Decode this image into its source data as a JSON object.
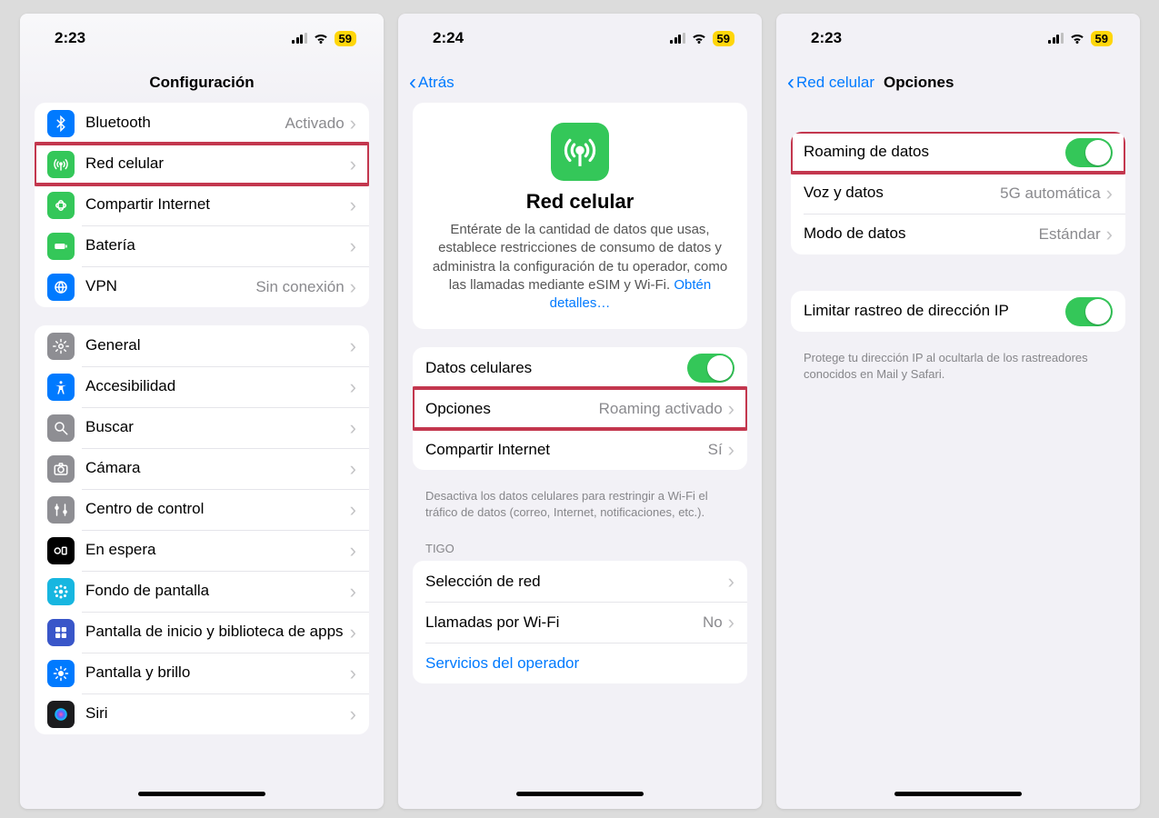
{
  "screen1": {
    "time": "2:23",
    "battery": "59",
    "title": "Configuración",
    "group1": [
      {
        "icon": "bluetooth",
        "bg": "#007aff",
        "label": "Bluetooth",
        "value": "Activado"
      },
      {
        "icon": "cellular",
        "bg": "#34c759",
        "label": "Red celular",
        "value": "",
        "hl": true
      },
      {
        "icon": "hotspot",
        "bg": "#34c759",
        "label": "Compartir Internet",
        "value": ""
      },
      {
        "icon": "battery",
        "bg": "#34c759",
        "label": "Batería",
        "value": ""
      },
      {
        "icon": "vpn",
        "bg": "#007aff",
        "label": "VPN",
        "value": "Sin conexión"
      }
    ],
    "group2": [
      {
        "icon": "general",
        "bg": "#8e8e93",
        "label": "General"
      },
      {
        "icon": "accessibility",
        "bg": "#007aff",
        "label": "Accesibilidad"
      },
      {
        "icon": "search",
        "bg": "#8e8e93",
        "label": "Buscar"
      },
      {
        "icon": "camera",
        "bg": "#8e8e93",
        "label": "Cámara"
      },
      {
        "icon": "control",
        "bg": "#8e8e93",
        "label": "Centro de control"
      },
      {
        "icon": "standby",
        "bg": "#000000",
        "label": "En espera"
      },
      {
        "icon": "wallpaper",
        "bg": "#17b6e0",
        "label": "Fondo de pantalla"
      },
      {
        "icon": "homescreen",
        "bg": "#3956c9",
        "label": "Pantalla de inicio y biblioteca de apps",
        "two": true
      },
      {
        "icon": "display",
        "bg": "#007aff",
        "label": "Pantalla y brillo"
      },
      {
        "icon": "siri",
        "bg": "#1c1c1e",
        "label": "Siri"
      }
    ]
  },
  "screen2": {
    "time": "2:24",
    "battery": "59",
    "back": "Atrás",
    "hero_title": "Red celular",
    "hero_text": "Entérate de la cantidad de datos que usas, establece restricciones de consumo de datos y administra la configuración de tu operador, como las llamadas mediante eSIM y Wi-Fi. ",
    "hero_link": "Obtén detalles…",
    "group1": [
      {
        "label": "Datos celulares",
        "type": "toggle"
      },
      {
        "label": "Opciones",
        "value": "Roaming activado",
        "hl": true
      },
      {
        "label": "Compartir Internet",
        "value": "Sí"
      }
    ],
    "footer1": "Desactiva los datos celulares para restringir a Wi-Fi el tráfico de datos (correo, Internet, notificaciones, etc.).",
    "section": "TIGO",
    "group2": [
      {
        "label": "Selección de red",
        "value": ""
      },
      {
        "label": "Llamadas por Wi-Fi",
        "value": "No"
      },
      {
        "label": "Servicios del operador",
        "type": "link"
      }
    ]
  },
  "screen3": {
    "time": "2:23",
    "battery": "59",
    "back": "Red celular",
    "title": "Opciones",
    "group1": [
      {
        "label": "Roaming de datos",
        "type": "toggle",
        "hl": true
      },
      {
        "label": "Voz y datos",
        "value": "5G automática"
      },
      {
        "label": "Modo de datos",
        "value": "Estándar"
      }
    ],
    "group2": [
      {
        "label": "Limitar rastreo de dirección IP",
        "type": "toggle"
      }
    ],
    "footer2": "Protege tu dirección IP al ocultarla de los rastreadores conocidos en Mail y Safari."
  }
}
